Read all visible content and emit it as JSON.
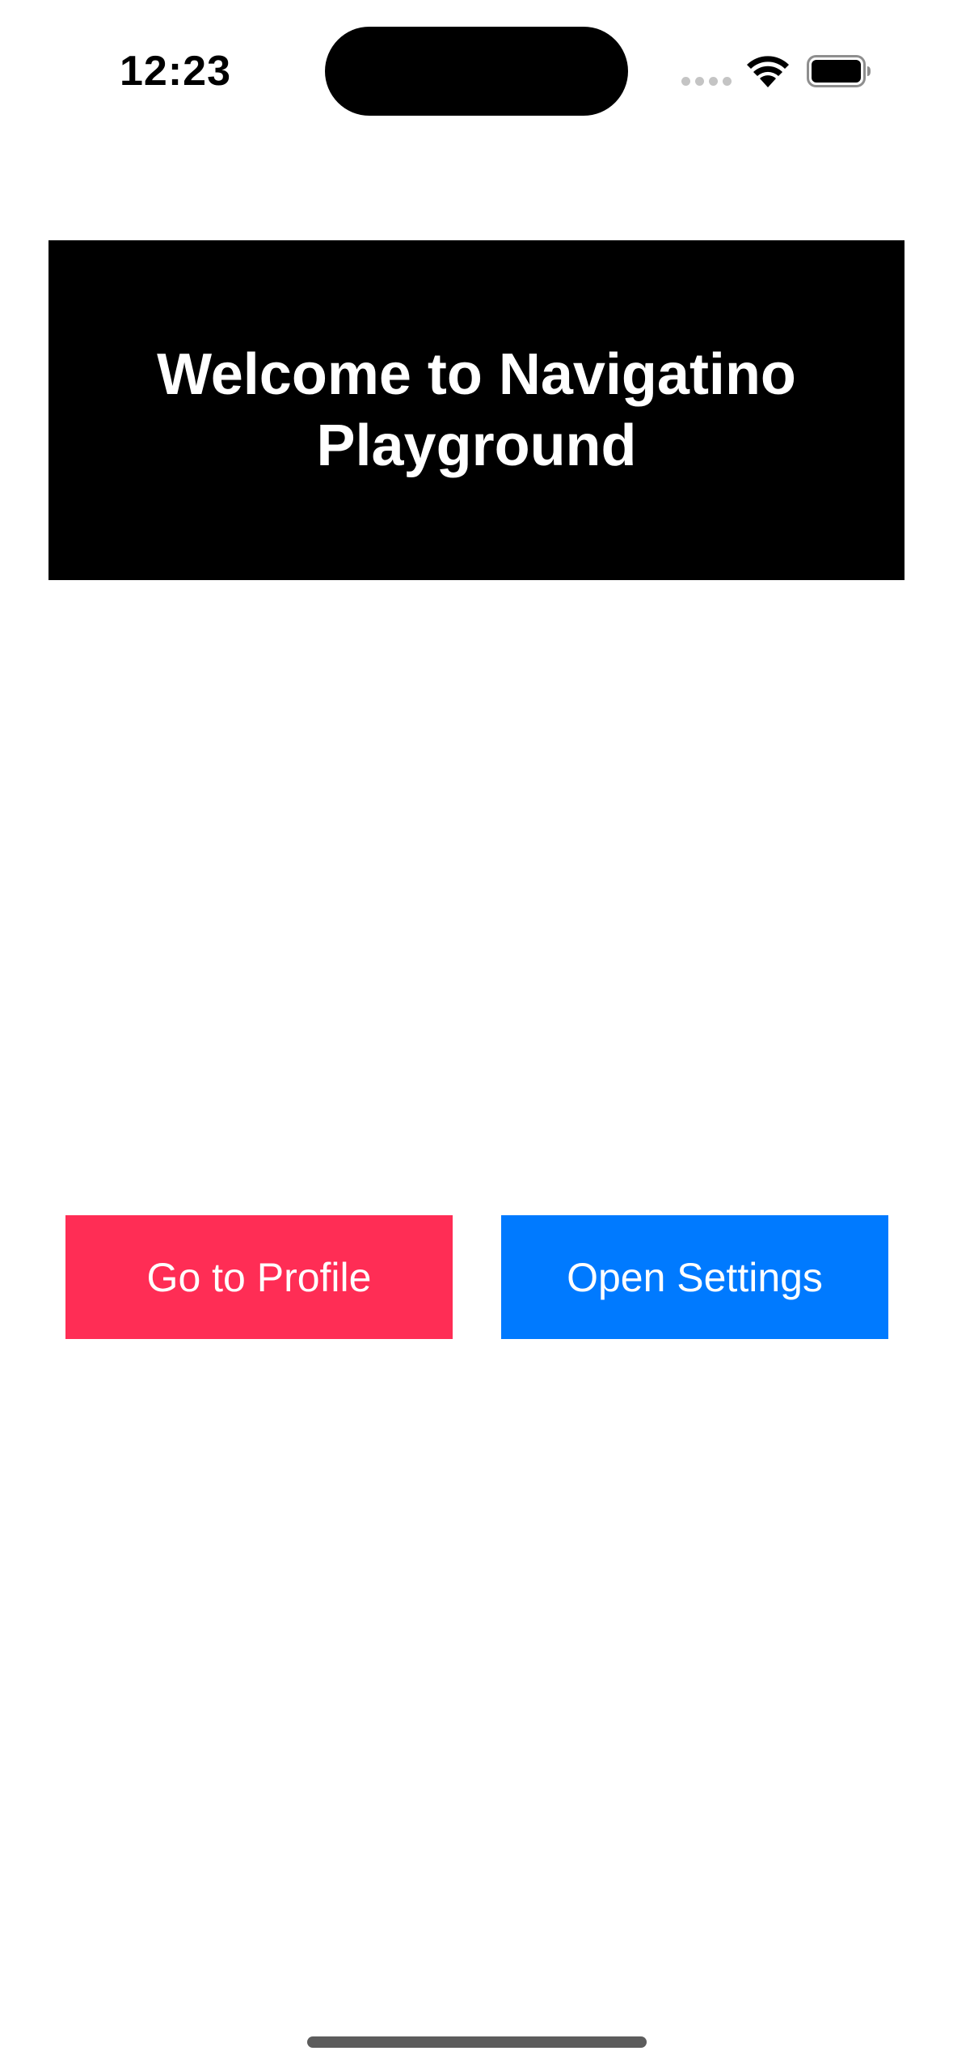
{
  "status_bar": {
    "time": "12:23"
  },
  "header": {
    "title": "Welcome to Navigatino Playground",
    "background_color": "#000000",
    "text_color": "#ffffff"
  },
  "actions": {
    "profile_label": "Go to Profile",
    "profile_color": "#ff2d55",
    "settings_label": "Open Settings",
    "settings_color": "#007aff"
  },
  "icons": {
    "signal": "cellular-signal-icon",
    "wifi": "wifi-icon",
    "battery": "battery-icon"
  }
}
